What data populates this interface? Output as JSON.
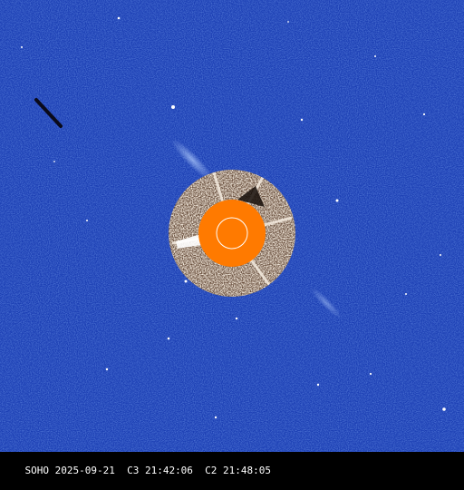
{
  "image": {
    "caption": "SOHO 2025-09-21  C3 21:42:06  C2 21:48:05",
    "colors": {
      "background": "#1c3fb4",
      "background_noise_light": "#3a62d6",
      "background_noise_dark": "#102a8a",
      "inner_field_light": "#f2e8d8",
      "inner_field_dark": "#3a2418",
      "occulting_disk": "#ff7a00",
      "sun_outline": "#ffffff",
      "caption_bar": "#000000",
      "caption_text": "#ffffff"
    }
  }
}
